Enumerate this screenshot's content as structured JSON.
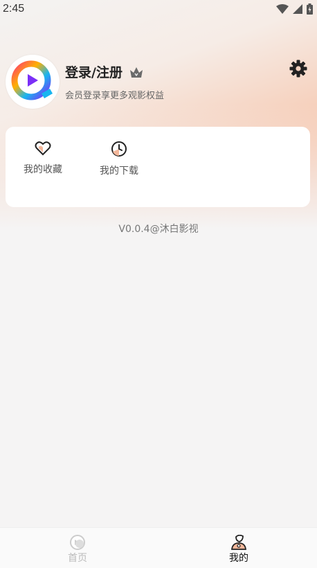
{
  "status_bar": {
    "time": "2:45"
  },
  "profile": {
    "title": "登录/注册",
    "subtitle": "会员登录享更多观影权益",
    "avatar_icon": "play-logo-icon",
    "crown_icon": "vip-crown-icon",
    "settings_icon": "gear-icon"
  },
  "shortcuts": [
    {
      "label": "我的收藏",
      "icon": "heart-icon"
    },
    {
      "label": "我的下载",
      "icon": "download-clock-icon"
    }
  ],
  "version": "V0.0.4@沐白影视",
  "tabs": [
    {
      "label": "首页",
      "icon": "home-icon",
      "active": false
    },
    {
      "label": "我的",
      "icon": "profile-icon",
      "active": true
    }
  ],
  "colors": {
    "accent": "#f3b79b",
    "brand_purple": "#7b2ff7",
    "brand_blue": "#18b5f0"
  }
}
